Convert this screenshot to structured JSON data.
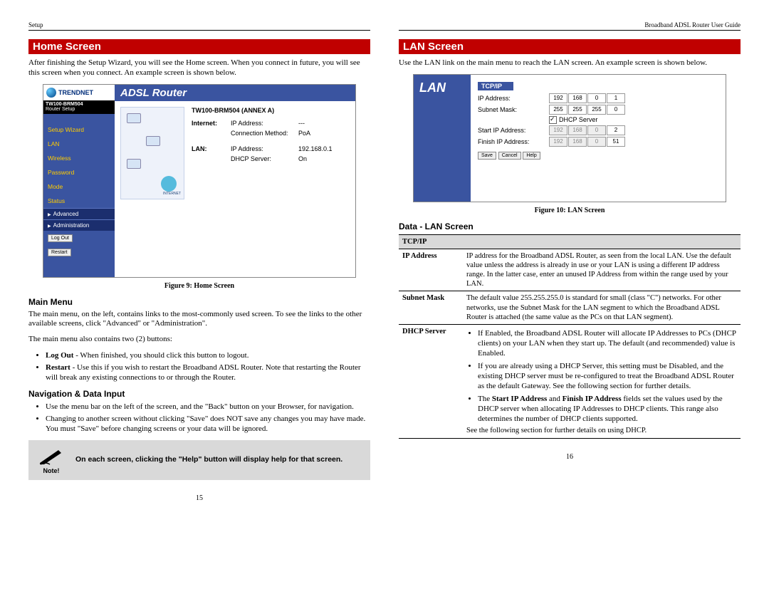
{
  "left": {
    "header_left": "Setup",
    "header_right": "",
    "banner": "Home Screen",
    "intro": "After finishing the Setup Wizard, you will see the Home screen. When you connect in future, you will see this screen when you connect. An example screen is shown below.",
    "figure_caption": "Figure 9: Home Screen",
    "main_menu_heading": "Main Menu",
    "main_menu_p1": "The main menu, on the left, contains links to the most-commonly used screen. To see the links to the other available screens, click \"Advanced\" or \"Administration\".",
    "main_menu_p2": "The main menu also contains two (2) buttons:",
    "bullets_mm": [
      "Log Out - When finished, you should click this button to logout.",
      "Restart - Use this if you wish to restart the Broadband ADSL Router. Note that restarting the Router will break any existing connections to or through the Router."
    ],
    "nav_heading": "Navigation & Data Input",
    "bullets_nav": [
      "Use the menu bar on the left of the screen, and the \"Back\" button on your Browser, for navigation.",
      "Changing to another screen without clicking \"Save\" does NOT save any changes you may have made. You must \"Save\" before changing screens or your data will be ignored."
    ],
    "note_label": "Note!",
    "note_text": "On each screen, clicking the \"Help\" button will display help for that screen.",
    "page_num": "15",
    "ss": {
      "logo": "TRENDNET",
      "model_line1": "TW100-BRM504",
      "model_line2": "Router Setup",
      "menu": [
        "Setup Wizard",
        "LAN",
        "Wireless",
        "Password",
        "Mode",
        "Status"
      ],
      "submenu": [
        "Advanced",
        "Administration"
      ],
      "btn_logout": "Log Out",
      "btn_restart": "Restart",
      "title": "ADSL Router",
      "annex": "TW100-BRM504 (ANNEX A)",
      "sec_internet": "Internet:",
      "ip_addr_lbl": "IP Address:",
      "ip_addr_val_inet": "---",
      "conn_method_lbl": "Connection Method:",
      "conn_method_val": "PoA",
      "sec_lan": "LAN:",
      "ip_addr_val_lan": "192.168.0.1",
      "dhcp_lbl": "DHCP Server:",
      "dhcp_val": "On",
      "internet_tag": "INTERNET"
    }
  },
  "right": {
    "header_left": "",
    "header_right": "Broadband ADSL Router User Guide",
    "banner": "LAN Screen",
    "intro": "Use the LAN link on the main menu to reach the LAN screen. An example screen is shown below.",
    "figure_caption": "Figure 10: LAN Screen",
    "data_heading": "Data - LAN Screen",
    "table_section": "TCP/IP",
    "page_num": "16",
    "ss": {
      "title": "LAN",
      "tcpip": "TCP/IP",
      "ip_label": "IP Address:",
      "ip_vals": [
        "192",
        "168",
        "0",
        "1"
      ],
      "subnet_label": "Subnet Mask:",
      "subnet_vals": [
        "255",
        "255",
        "255",
        "0"
      ],
      "dhcp_check": "DHCP Server",
      "start_label": "Start IP Address:",
      "start_vals": [
        "192",
        "168",
        "0",
        "2"
      ],
      "finish_label": "Finish IP Address:",
      "finish_vals": [
        "192",
        "168",
        "0",
        "51"
      ],
      "btn_save": "Save",
      "btn_cancel": "Cancel",
      "btn_help": "Help"
    },
    "rows": [
      {
        "label": "IP Address",
        "text": "IP address for the Broadband ADSL Router, as seen from the local LAN. Use the default value unless the address is already in use or your LAN is using a different IP address range. In the latter case, enter an unused IP Address from within the range used by your LAN."
      },
      {
        "label": "Subnet Mask",
        "text": "The default value 255.255.255.0 is standard for small (class \"C\") networks. For other networks, use the Subnet Mask for the LAN segment to which the Broadband ADSL Router is attached (the same value as the PCs on that LAN segment)."
      },
      {
        "label": "DHCP Server",
        "bullets": [
          "If Enabled, the Broadband ADSL Router will allocate IP Addresses to PCs (DHCP clients) on your LAN when they start up. The default (and recommended) value is Enabled.",
          "If you are already using a DHCP Server, this setting must be Disabled, and the existing DHCP server must be re-configured to treat the Broadband ADSL Router as the default Gateway. See the following section for further details.",
          "The Start IP Address and Finish IP Address fields set the values used by the DHCP server when allocating IP Addresses to DHCP clients. This range also determines the number of DHCP clients supported."
        ],
        "tail": "See the following section for further details on using DHCP."
      }
    ]
  }
}
